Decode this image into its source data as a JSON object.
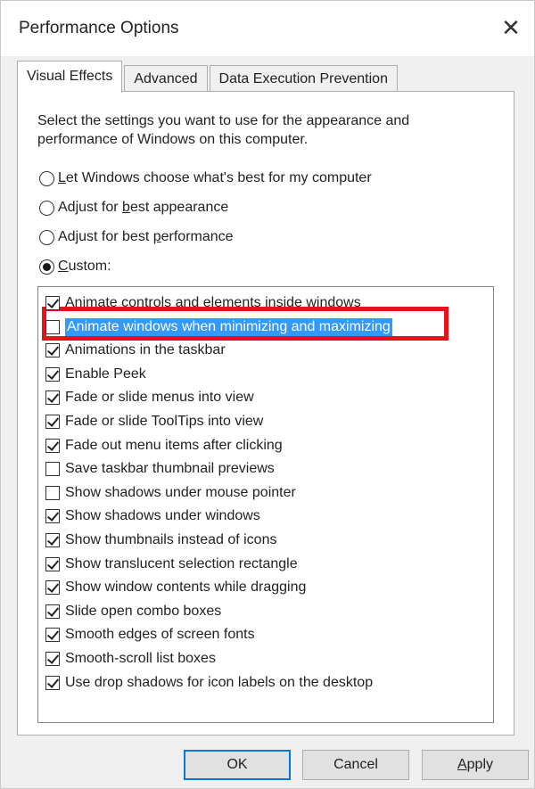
{
  "window": {
    "title": "Performance Options",
    "close_glyph": "✕"
  },
  "tabs": [
    {
      "label": "Visual Effects",
      "active": true
    },
    {
      "label": "Advanced",
      "active": false
    },
    {
      "label": "Data Execution Prevention",
      "active": false
    }
  ],
  "description": "Select the settings you want to use for the appearance and performance of Windows on this computer.",
  "radios": [
    {
      "pre": "",
      "u": "L",
      "post": "et Windows choose what's best for my computer",
      "selected": false
    },
    {
      "pre": "Adjust for ",
      "u": "b",
      "post": "est appearance",
      "selected": false
    },
    {
      "pre": "Adjust for best ",
      "u": "p",
      "post": "erformance",
      "selected": false
    },
    {
      "pre": "",
      "u": "C",
      "post": "ustom:",
      "selected": true
    }
  ],
  "effects": [
    {
      "label": "Animate controls and elements inside windows",
      "checked": true
    },
    {
      "label": "Animate windows when minimizing and maximizing",
      "checked": false,
      "selected": true
    },
    {
      "label": "Animations in the taskbar",
      "checked": true
    },
    {
      "label": "Enable Peek",
      "checked": true
    },
    {
      "label": "Fade or slide menus into view",
      "checked": true
    },
    {
      "label": "Fade or slide ToolTips into view",
      "checked": true
    },
    {
      "label": "Fade out menu items after clicking",
      "checked": true
    },
    {
      "label": "Save taskbar thumbnail previews",
      "checked": false
    },
    {
      "label": "Show shadows under mouse pointer",
      "checked": false
    },
    {
      "label": "Show shadows under windows",
      "checked": true
    },
    {
      "label": "Show thumbnails instead of icons",
      "checked": true
    },
    {
      "label": "Show translucent selection rectangle",
      "checked": true
    },
    {
      "label": "Show window contents while dragging",
      "checked": true
    },
    {
      "label": "Slide open combo boxes",
      "checked": true
    },
    {
      "label": "Smooth edges of screen fonts",
      "checked": true
    },
    {
      "label": "Smooth-scroll list boxes",
      "checked": true
    },
    {
      "label": "Use drop shadows for icon labels on the desktop",
      "checked": true
    }
  ],
  "buttons": {
    "ok": "OK",
    "cancel": "Cancel",
    "apply_pre": "",
    "apply_u": "A",
    "apply_post": "pply"
  },
  "colors": {
    "highlight_box": "#e8101a",
    "selection": "#3399ff",
    "default_button_border": "#0078d7"
  }
}
